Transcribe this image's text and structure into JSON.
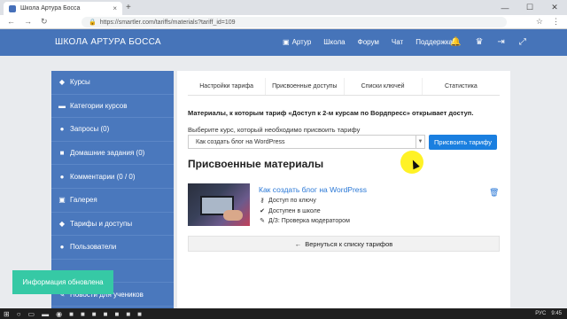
{
  "browser": {
    "tab_title": "Школа Артура Босса",
    "tab_close": "×",
    "new_tab": "+",
    "url": "https://smartler.com/tariffs/materials?tariff_id=109",
    "window_controls": [
      "—",
      "☐",
      "✕"
    ]
  },
  "header": {
    "brand": "ШКОЛА АРТУРА БОССА",
    "menu": [
      {
        "label": "Артур",
        "icon": "user-icon"
      },
      {
        "label": "Школа"
      },
      {
        "label": "Форум"
      },
      {
        "label": "Чат"
      },
      {
        "label": "Поддержка"
      }
    ]
  },
  "sidebar": {
    "items": [
      {
        "label": "Курсы",
        "icon": "tag-icon",
        "glyph": "◆"
      },
      {
        "label": "Категории курсов",
        "icon": "folder-icon",
        "glyph": "▬"
      },
      {
        "label": "Запросы (0)",
        "icon": "chat-icon",
        "glyph": "●"
      },
      {
        "label": "Домашние задания (0)",
        "icon": "briefcase-icon",
        "glyph": "■"
      },
      {
        "label": "Комментарии (0 / 0)",
        "icon": "comments-icon",
        "glyph": "●"
      },
      {
        "label": "Галерея",
        "icon": "image-icon",
        "glyph": "▣"
      },
      {
        "label": "Тарифы и доступы",
        "icon": "tags-icon",
        "glyph": "◆"
      },
      {
        "label": "Пользователи",
        "icon": "users-icon",
        "glyph": "●"
      },
      {
        "label": "",
        "icon": "blank-icon",
        "glyph": ""
      },
      {
        "label": "Новости для учеников",
        "icon": "pencil-icon",
        "glyph": "✎"
      }
    ]
  },
  "main": {
    "tabs": [
      "Настройки тарифа",
      "Присвоенные доступы",
      "Списки ключей",
      "Статистика"
    ],
    "description": "Материалы, к которым тариф «Доступ к 2-м курсам по Вордпресс» открывает доступ.",
    "select_label": "Выберите курс, который необходимо присвоить тарифу",
    "select_value": "Как создать блог на WordPress",
    "assign_button": "Присвоить тарифу",
    "section_title": "Присвоенные материалы",
    "material": {
      "title": "Как создать блог на WordPress",
      "lines": [
        {
          "icon": "key-icon",
          "glyph": "⚷",
          "text": "Доступ по ключу"
        },
        {
          "icon": "check-icon",
          "glyph": "✔",
          "text": "Доступен в школе"
        },
        {
          "icon": "pencil-icon",
          "glyph": "✎",
          "text": "Д/З: Проверка модератором"
        }
      ]
    },
    "back_button": "Вернуться к списку тарифов"
  },
  "toast": "Информация обновлена",
  "taskbar": {
    "lang": "РУС",
    "time": "9:45"
  },
  "colors": {
    "header": "#4674b9",
    "sidebar": "#4a78bd",
    "primary": "#1a7fe0",
    "link": "#2a78d6",
    "toast": "#36c9a5"
  }
}
